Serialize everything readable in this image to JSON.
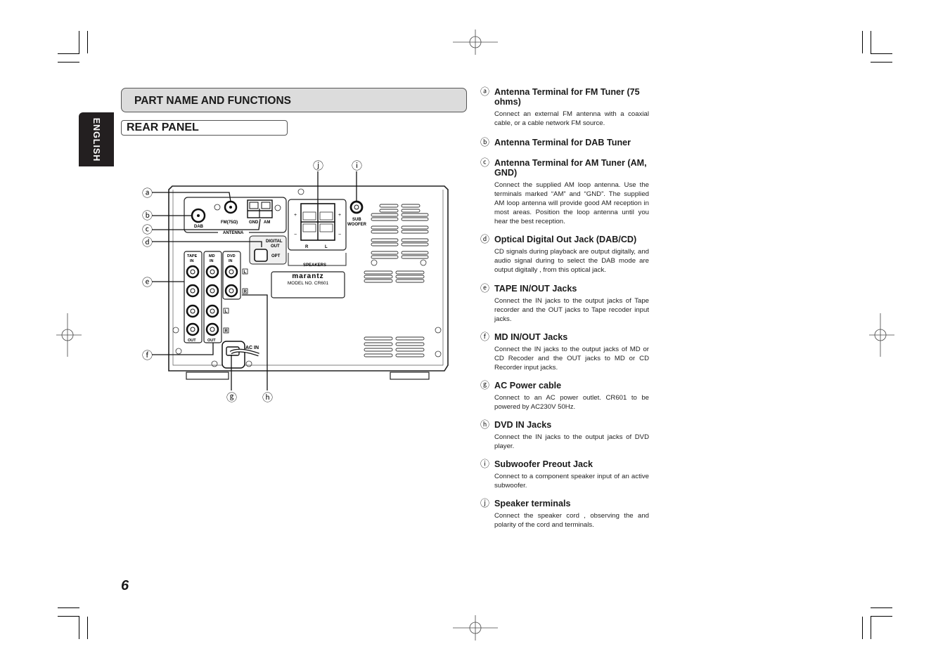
{
  "page": {
    "language_tab": "ENGLISH",
    "section_title": "PART NAME AND FUNCTIONS",
    "subsection_title": "REAR PANEL",
    "page_number": "6"
  },
  "diagram": {
    "callouts": [
      "ⓐ",
      "ⓑ",
      "ⓒ",
      "ⓓ",
      "ⓔ",
      "ⓕ",
      "ⓖ",
      "ⓗ",
      "ⓘ",
      "ⓙ"
    ],
    "labels": {
      "dab": "DAB",
      "fm": "FM(75Ω)",
      "gnd": "GND",
      "am": "AM",
      "antenna": "ANTENNA",
      "digital_out": "DIGITAL",
      "digital_out2": "OUT",
      "opt": "OPT",
      "tape": "TAPE",
      "md": "MD",
      "dvd": "DVD",
      "in": "IN",
      "out": "OUT",
      "left": "L",
      "right": "R",
      "speakers": "SPEAKERS",
      "sub": "SUB",
      "woofer": "WOOFER",
      "plus": "+",
      "minus": "−",
      "brand": "marantz",
      "model": "MODEL NO. CR601",
      "ac_in": "AC IN"
    }
  },
  "items": [
    {
      "marker": "ⓐ",
      "title": "Antenna Terminal for FM Tuner (75 ohms)",
      "description": "Connect an external FM antenna with a coaxial cable, or a cable network FM source."
    },
    {
      "marker": "ⓑ",
      "title": "Antenna Terminal for DAB Tuner",
      "description": ""
    },
    {
      "marker": "ⓒ",
      "title": "Antenna Terminal for AM Tuner (AM, GND)",
      "description": "Connect the supplied AM loop antenna. Use the terminals marked “AM” and “GND”. The supplied AM loop antenna will provide good AM reception in most areas. Position the loop antenna until you hear the best reception."
    },
    {
      "marker": "ⓓ",
      "title": "Optical Digital Out Jack (DAB/CD)",
      "description": "CD signals during playback are output digitally, and audio signal during to select the DAB mode are output digitally , from this optical jack."
    },
    {
      "marker": "ⓔ",
      "title": "TAPE IN/OUT Jacks",
      "description": "Connect the IN jacks to the output jacks of Tape recorder and the OUT jacks to Tape recoder  input jacks."
    },
    {
      "marker": "ⓕ",
      "title": "MD IN/OUT Jacks",
      "description": "Connect the IN jacks to the output jacks of MD or CD Recoder and the OUT jacks to MD or CD Recorder  input jacks."
    },
    {
      "marker": "ⓖ",
      "title": "AC Power cable",
      "description": "Connect to an AC power outlet.  CR601 to be powered by AC230V 50Hz."
    },
    {
      "marker": "ⓗ",
      "title": "DVD IN Jacks",
      "description": "Connect the IN jacks to the output jacks of DVD player."
    },
    {
      "marker": "ⓘ",
      "title": "Subwoofer Preout Jack",
      "description": "Connect to a component speaker input of an active subwoofer."
    },
    {
      "marker": "ⓙ",
      "title": "Speaker terminals",
      "description": "Connect the speaker cord , observing the and polarity of the cord and terminals."
    }
  ]
}
